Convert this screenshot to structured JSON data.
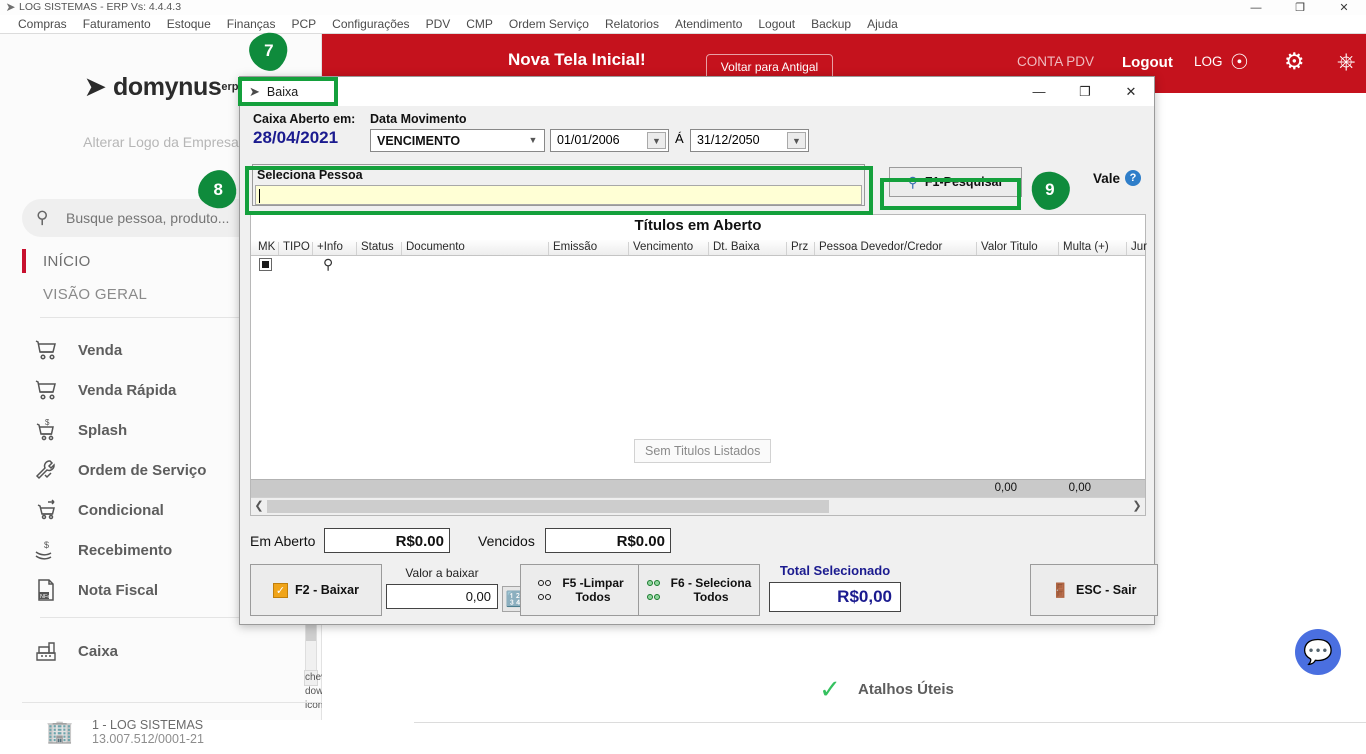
{
  "os_window": {
    "title": "LOG SISTEMAS - ERP Vs: 4.4.4.3",
    "logo_icon": "domynus-swoosh-icon",
    "minimize": "—",
    "restore": "❐",
    "close": "✕"
  },
  "menubar": {
    "items": [
      "Compras",
      "Faturamento",
      "Estoque",
      "Finanças",
      "PCP",
      "Configurações",
      "PDV",
      "CMP",
      "Ordem Serviço",
      "Relatorios",
      "Atendimento",
      "Logout",
      "Backup",
      "Ajuda"
    ]
  },
  "sidebar": {
    "logo_text": "domynus",
    "logo_sup": "erp",
    "logo_icon": "domynus-swoosh-icon",
    "alterar_logo": "Alterar Logo da Empresa",
    "search": {
      "placeholder": "Busque pessoa, produto...",
      "value": "",
      "icon": "search-icon"
    },
    "inicio": "INÍCIO",
    "visao_geral": "VISÃO GERAL",
    "items": [
      {
        "label": "Venda",
        "icon": "cart-icon"
      },
      {
        "label": "Venda Rápida",
        "icon": "cart-icon"
      },
      {
        "label": "Splash",
        "icon": "cart-dollar-icon"
      },
      {
        "label": "Ordem de Serviço",
        "icon": "wrench-check-icon"
      },
      {
        "label": "Condicional",
        "icon": "cart-arrow-icon"
      },
      {
        "label": "Recebimento",
        "icon": "hand-dollar-icon"
      },
      {
        "label": "Nota Fiscal",
        "icon": "nfe-document-icon"
      },
      {
        "label": "Caixa",
        "icon": "cash-register-icon"
      }
    ],
    "company": {
      "name": "1 - LOG SISTEMAS",
      "cnpj": "13.007.512/0001-21",
      "icon": "building-icon"
    },
    "scroll_down_icon": "chevron-down-icon"
  },
  "topbar": {
    "title": "Nova Tela Inicial!",
    "voltar_button": "Voltar para Antigal",
    "conta_pdv": "CONTA PDV",
    "logout": "Logout",
    "log": "LOG",
    "user_icon": "user-circle-icon",
    "gear_icon": "gear-icon",
    "power_icon": "power-icon",
    "background_color": "#c5121d"
  },
  "main": {
    "atalhos": {
      "label": "Atalhos Úteis",
      "icon": "green-check-badge-icon"
    },
    "chat_icon": "chat-bubble-icon"
  },
  "dialog": {
    "title": "Baixa",
    "title_icon": "domynus-swoosh-icon",
    "minimize": "—",
    "maximize": "❐",
    "close": "✕",
    "caixa_aberto_label": "Caixa Aberto em:",
    "caixa_aberto_value": "28/04/2021",
    "data_movimento_label": "Data Movimento",
    "data_movimento_value": "VENCIMENTO",
    "date_from": "01/01/2006",
    "date_separator": "Á",
    "date_to": "31/12/2050",
    "seleciona_pessoa_label": "Seleciona Pessoa",
    "seleciona_pessoa_value": "",
    "pesquisar_button": "F1-Pesquisar",
    "pesquisar_icon": "search-magnifier-icon",
    "vale_label": "Vale",
    "vale_help_icon": "help-question-icon",
    "grid": {
      "title": "Títulos em Aberto",
      "columns": [
        "MK",
        "TIPO",
        "+Info",
        "Status",
        "Documento",
        "Emissão",
        "Vencimento",
        "Dt. Baixa",
        "Prz",
        "Pessoa Devedor/Credor",
        "Valor Titulo",
        "Multa (+)",
        "Jur"
      ],
      "empty_message": "Sem Titulos Listados",
      "info_icon": "magnifier-icon",
      "mk_checkbox_icon": "checkbox-filled-icon",
      "footer_totals": [
        "0,00",
        "0,00"
      ],
      "scroll_left_icon": "chevron-left-icon",
      "scroll_right_icon": "chevron-right-icon"
    },
    "em_aberto_label": "Em Aberto",
    "em_aberto_value": "R$0.00",
    "vencidos_label": "Vencidos",
    "vencidos_value": "R$0.00",
    "baixar_button": "F2 - Baixar",
    "baixar_icon": "orange-check-icon",
    "valor_baixar_label": "Valor a baixar",
    "valor_baixar_value": "0,00",
    "calculator_icon": "calculator-icon",
    "f5_button_line1": "F5 -Limpar",
    "f5_button_line2": "Todos",
    "f5_icon": "four-circles-icon",
    "f6_button_line1": "F6 - Seleciona",
    "f6_button_line2": "Todos",
    "f6_icon": "four-circles-green-icon",
    "total_selecionado_label": "Total Selecionado",
    "total_selecionado_value": "R$0,00",
    "sair_button": "ESC - Sair",
    "sair_icon": "exit-door-icon"
  },
  "callouts": {
    "badge_7": "7",
    "badge_8": "8",
    "badge_9": "9",
    "highlight_color": "#14a03c"
  }
}
